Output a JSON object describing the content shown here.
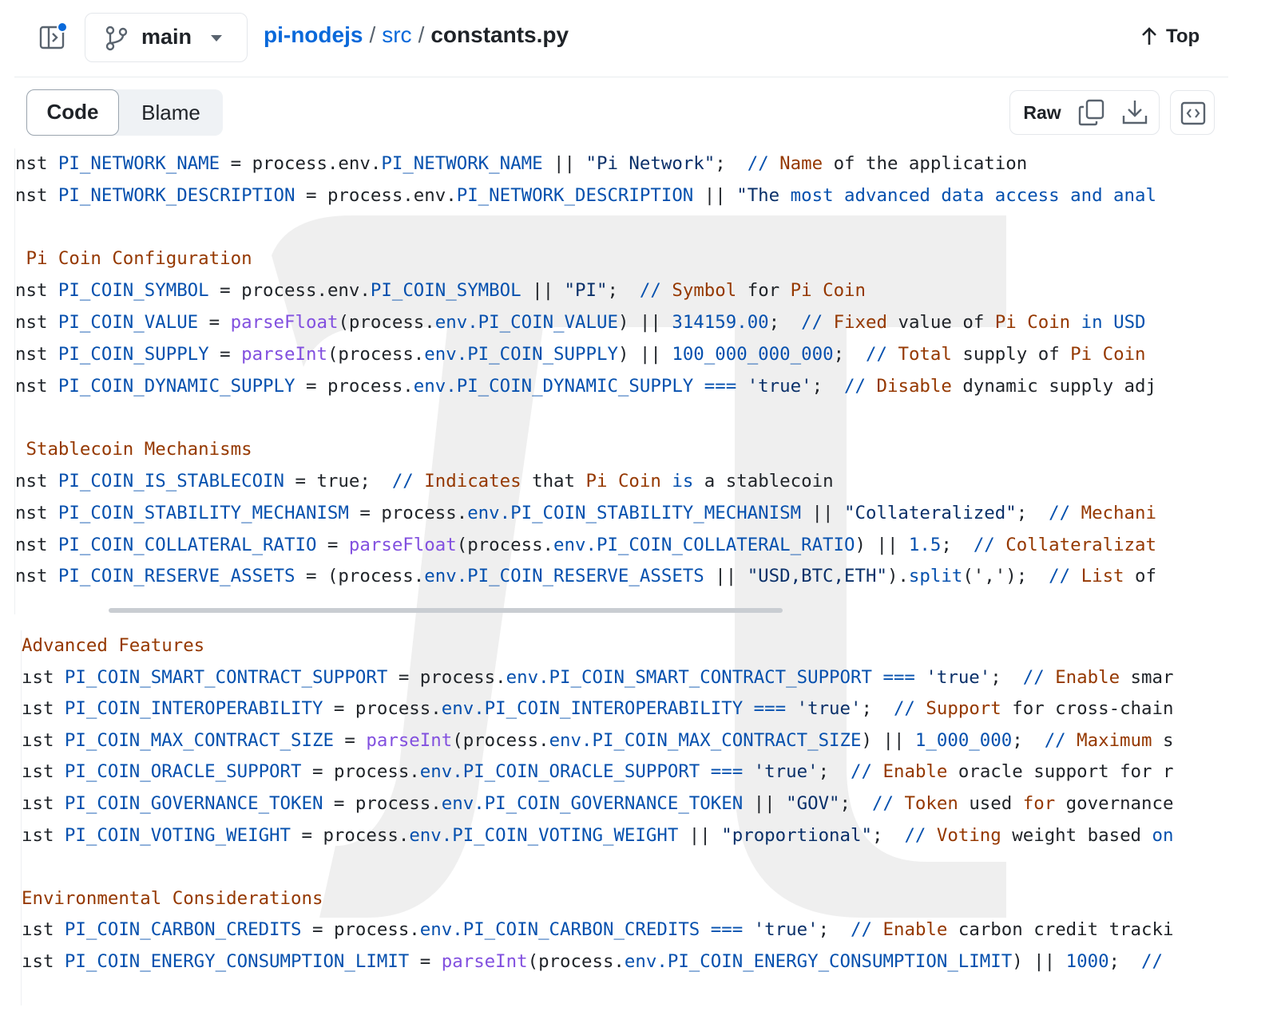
{
  "header": {
    "branch": "main",
    "breadcrumb": {
      "repo": "pi-nodejs",
      "sep1": "/",
      "folder": "src",
      "sep2": "/",
      "file": "constants.py"
    },
    "top_label": "Top"
  },
  "toolbar": {
    "code_tab": "Code",
    "blame_tab": "Blame",
    "raw_label": "Raw"
  },
  "icons": {
    "sidebar": "sidebar-toggle-icon",
    "branch": "git-branch-icon",
    "caret": "chevron-down-icon",
    "top": "arrow-up-icon",
    "copy": "copy-icon",
    "download": "download-icon",
    "symbols": "code-square-icon"
  },
  "colors": {
    "link": "#0969da",
    "notification_dot": "#0969da",
    "identifier": "#0550ae",
    "function": "#8250df",
    "string": "#0a3069",
    "comment": "#953800"
  },
  "code_pane_1": [
    [
      [
        "t-pl",
        "nst "
      ],
      [
        "t-id",
        "PI_NETWORK_NAME"
      ],
      [
        "t-pl",
        " = process.env."
      ],
      [
        "t-id",
        "PI_NETWORK_NAME"
      ],
      [
        "t-pl",
        " || "
      ],
      [
        "t-str",
        "\"Pi Network\""
      ],
      [
        "t-pl",
        ";  "
      ],
      [
        "t-id",
        "// "
      ],
      [
        "t-cm",
        "Name"
      ],
      [
        "t-pl",
        " of the application"
      ]
    ],
    [
      [
        "t-pl",
        "nst "
      ],
      [
        "t-id",
        "PI_NETWORK_DESCRIPTION"
      ],
      [
        "t-pl",
        " = process.env."
      ],
      [
        "t-id",
        "PI_NETWORK_DESCRIPTION"
      ],
      [
        "t-pl",
        " || "
      ],
      [
        "t-str",
        "\"The "
      ],
      [
        "t-id",
        "most advanced data access and anal"
      ]
    ],
    [],
    [
      [
        "t-cm",
        " Pi Coin Configuration"
      ]
    ],
    [
      [
        "t-pl",
        "nst "
      ],
      [
        "t-id",
        "PI_COIN_SYMBOL"
      ],
      [
        "t-pl",
        " = process.env."
      ],
      [
        "t-id",
        "PI_COIN_SYMBOL"
      ],
      [
        "t-pl",
        " || "
      ],
      [
        "t-str",
        "\"PI\""
      ],
      [
        "t-pl",
        ";  "
      ],
      [
        "t-id",
        "// "
      ],
      [
        "t-cm",
        "Symbol"
      ],
      [
        "t-pl",
        " for "
      ],
      [
        "t-cm",
        "Pi Coin"
      ]
    ],
    [
      [
        "t-pl",
        "nst "
      ],
      [
        "t-id",
        "PI_COIN_VALUE"
      ],
      [
        "t-pl",
        " = "
      ],
      [
        "t-fn",
        "parseFloat"
      ],
      [
        "t-pl",
        "(process."
      ],
      [
        "t-id",
        "env.PI_COIN_VALUE"
      ],
      [
        "t-pl",
        ") || "
      ],
      [
        "t-num",
        "314159.00"
      ],
      [
        "t-pl",
        ";  "
      ],
      [
        "t-id",
        "// "
      ],
      [
        "t-cm",
        "Fixed"
      ],
      [
        "t-pl",
        " value of "
      ],
      [
        "t-cm",
        "Pi Coin"
      ],
      [
        "t-id",
        " in USD"
      ]
    ],
    [
      [
        "t-pl",
        "nst "
      ],
      [
        "t-id",
        "PI_COIN_SUPPLY"
      ],
      [
        "t-pl",
        " = "
      ],
      [
        "t-fn",
        "parseInt"
      ],
      [
        "t-pl",
        "(process."
      ],
      [
        "t-id",
        "env.PI_COIN_SUPPLY"
      ],
      [
        "t-pl",
        ") || "
      ],
      [
        "t-num",
        "100_000_000_000"
      ],
      [
        "t-pl",
        ";  "
      ],
      [
        "t-id",
        "// "
      ],
      [
        "t-cm",
        "Total"
      ],
      [
        "t-pl",
        " supply of "
      ],
      [
        "t-cm",
        "Pi Coin"
      ]
    ],
    [
      [
        "t-pl",
        "nst "
      ],
      [
        "t-id",
        "PI_COIN_DYNAMIC_SUPPLY"
      ],
      [
        "t-pl",
        " = process."
      ],
      [
        "t-id",
        "env.PI_COIN_DYNAMIC_SUPPLY"
      ],
      [
        "t-op",
        " === "
      ],
      [
        "t-str",
        "'true'"
      ],
      [
        "t-pl",
        ";  "
      ],
      [
        "t-id",
        "// "
      ],
      [
        "t-cm",
        "Disable"
      ],
      [
        "t-pl",
        " dynamic supply adj"
      ]
    ],
    [],
    [
      [
        "t-cm",
        " Stablecoin Mechanisms"
      ]
    ],
    [
      [
        "t-pl",
        "nst "
      ],
      [
        "t-id",
        "PI_COIN_IS_STABLECOIN"
      ],
      [
        "t-pl",
        " = true;  "
      ],
      [
        "t-id",
        "// "
      ],
      [
        "t-cm",
        "Indicates"
      ],
      [
        "t-pl",
        " that "
      ],
      [
        "t-cm",
        "Pi Coin"
      ],
      [
        "t-id",
        " is"
      ],
      [
        "t-pl",
        " a stablecoin"
      ]
    ],
    [
      [
        "t-pl",
        "nst "
      ],
      [
        "t-id",
        "PI_COIN_STABILITY_MECHANISM"
      ],
      [
        "t-pl",
        " = process."
      ],
      [
        "t-id",
        "env.PI_COIN_STABILITY_MECHANISM"
      ],
      [
        "t-pl",
        " || "
      ],
      [
        "t-str",
        "\"Collateralized\""
      ],
      [
        "t-pl",
        ";  "
      ],
      [
        "t-id",
        "// "
      ],
      [
        "t-cm",
        "Mechani"
      ]
    ],
    [
      [
        "t-pl",
        "nst "
      ],
      [
        "t-id",
        "PI_COIN_COLLATERAL_RATIO"
      ],
      [
        "t-pl",
        " = "
      ],
      [
        "t-fn",
        "parseFloat"
      ],
      [
        "t-pl",
        "(process."
      ],
      [
        "t-id",
        "env.PI_COIN_COLLATERAL_RATIO"
      ],
      [
        "t-pl",
        ") || "
      ],
      [
        "t-num",
        "1.5"
      ],
      [
        "t-pl",
        ";  "
      ],
      [
        "t-id",
        "// "
      ],
      [
        "t-cm",
        "Collateralizat"
      ]
    ],
    [
      [
        "t-pl",
        "nst "
      ],
      [
        "t-id",
        "PI_COIN_RESERVE_ASSETS"
      ],
      [
        "t-pl",
        " = (process."
      ],
      [
        "t-id",
        "env.PI_COIN_RESERVE_ASSETS"
      ],
      [
        "t-pl",
        " || "
      ],
      [
        "t-str",
        "\"USD,BTC,ETH\""
      ],
      [
        "t-pl",
        ")."
      ],
      [
        "t-id",
        "split"
      ],
      [
        "t-pl",
        "(','"
      ],
      [
        "t-pl",
        ");  "
      ],
      [
        "t-id",
        "// "
      ],
      [
        "t-cm",
        "List"
      ],
      [
        "t-pl",
        " of"
      ]
    ]
  ],
  "code_pane_2": [
    [
      [
        "t-cm",
        "Advanced Features"
      ]
    ],
    [
      [
        "t-pl",
        "ıst "
      ],
      [
        "t-id",
        "PI_COIN_SMART_CONTRACT_SUPPORT"
      ],
      [
        "t-pl",
        " = process."
      ],
      [
        "t-id",
        "env.PI_COIN_SMART_CONTRACT_SUPPORT"
      ],
      [
        "t-op",
        " === "
      ],
      [
        "t-str",
        "'true'"
      ],
      [
        "t-pl",
        ";  "
      ],
      [
        "t-id",
        "// "
      ],
      [
        "t-cm",
        "Enable"
      ],
      [
        "t-pl",
        " smar"
      ]
    ],
    [
      [
        "t-pl",
        "ıst "
      ],
      [
        "t-id",
        "PI_COIN_INTEROPERABILITY"
      ],
      [
        "t-pl",
        " = process."
      ],
      [
        "t-id",
        "env.PI_COIN_INTEROPERABILITY"
      ],
      [
        "t-op",
        " === "
      ],
      [
        "t-str",
        "'true'"
      ],
      [
        "t-pl",
        ";  "
      ],
      [
        "t-id",
        "// "
      ],
      [
        "t-cm",
        "Support"
      ],
      [
        "t-pl",
        " for cross-chain"
      ]
    ],
    [
      [
        "t-pl",
        "ıst "
      ],
      [
        "t-id",
        "PI_COIN_MAX_CONTRACT_SIZE"
      ],
      [
        "t-pl",
        " = "
      ],
      [
        "t-fn",
        "parseInt"
      ],
      [
        "t-pl",
        "(process."
      ],
      [
        "t-id",
        "env.PI_COIN_MAX_CONTRACT_SIZE"
      ],
      [
        "t-pl",
        ") || "
      ],
      [
        "t-num",
        "1_000_000"
      ],
      [
        "t-pl",
        ";  "
      ],
      [
        "t-id",
        "// "
      ],
      [
        "t-cm",
        "Maximum"
      ],
      [
        "t-pl",
        " s"
      ]
    ],
    [
      [
        "t-pl",
        "ıst "
      ],
      [
        "t-id",
        "PI_COIN_ORACLE_SUPPORT"
      ],
      [
        "t-pl",
        " = process."
      ],
      [
        "t-id",
        "env.PI_COIN_ORACLE_SUPPORT"
      ],
      [
        "t-op",
        " === "
      ],
      [
        "t-str",
        "'true'"
      ],
      [
        "t-pl",
        ";  "
      ],
      [
        "t-id",
        "// "
      ],
      [
        "t-cm",
        "Enable"
      ],
      [
        "t-pl",
        " oracle support for r"
      ]
    ],
    [
      [
        "t-pl",
        "ıst "
      ],
      [
        "t-id",
        "PI_COIN_GOVERNANCE_TOKEN"
      ],
      [
        "t-pl",
        " = process."
      ],
      [
        "t-id",
        "env.PI_COIN_GOVERNANCE_TOKEN"
      ],
      [
        "t-pl",
        " || "
      ],
      [
        "t-str",
        "\"GOV\""
      ],
      [
        "t-pl",
        ";  "
      ],
      [
        "t-id",
        "// "
      ],
      [
        "t-cm",
        "Token"
      ],
      [
        "t-pl",
        " used "
      ],
      [
        "t-cm",
        "for"
      ],
      [
        "t-pl",
        " governance"
      ]
    ],
    [
      [
        "t-pl",
        "ıst "
      ],
      [
        "t-id",
        "PI_COIN_VOTING_WEIGHT"
      ],
      [
        "t-pl",
        " = process."
      ],
      [
        "t-id",
        "env.PI_COIN_VOTING_WEIGHT"
      ],
      [
        "t-pl",
        " || "
      ],
      [
        "t-str",
        "\"proportional\""
      ],
      [
        "t-pl",
        ";  "
      ],
      [
        "t-id",
        "// "
      ],
      [
        "t-cm",
        "Voting"
      ],
      [
        "t-pl",
        " weight based "
      ],
      [
        "t-id",
        "on"
      ]
    ],
    [],
    [
      [
        "t-cm",
        "Environmental Considerations"
      ]
    ],
    [
      [
        "t-pl",
        "ıst "
      ],
      [
        "t-id",
        "PI_COIN_CARBON_CREDITS"
      ],
      [
        "t-pl",
        " = process."
      ],
      [
        "t-id",
        "env.PI_COIN_CARBON_CREDITS"
      ],
      [
        "t-op",
        " === "
      ],
      [
        "t-str",
        "'true'"
      ],
      [
        "t-pl",
        ";  "
      ],
      [
        "t-id",
        "// "
      ],
      [
        "t-cm",
        "Enable"
      ],
      [
        "t-pl",
        " carbon credit tracki"
      ]
    ],
    [
      [
        "t-pl",
        "ıst "
      ],
      [
        "t-id",
        "PI_COIN_ENERGY_CONSUMPTION_LIMIT"
      ],
      [
        "t-pl",
        " = "
      ],
      [
        "t-fn",
        "parseInt"
      ],
      [
        "t-pl",
        "(process."
      ],
      [
        "t-id",
        "env.PI_COIN_ENERGY_CONSUMPTION_LIMIT"
      ],
      [
        "t-pl",
        ") || "
      ],
      [
        "t-num",
        "1000"
      ],
      [
        "t-pl",
        ";  "
      ],
      [
        "t-id",
        "//"
      ]
    ]
  ]
}
